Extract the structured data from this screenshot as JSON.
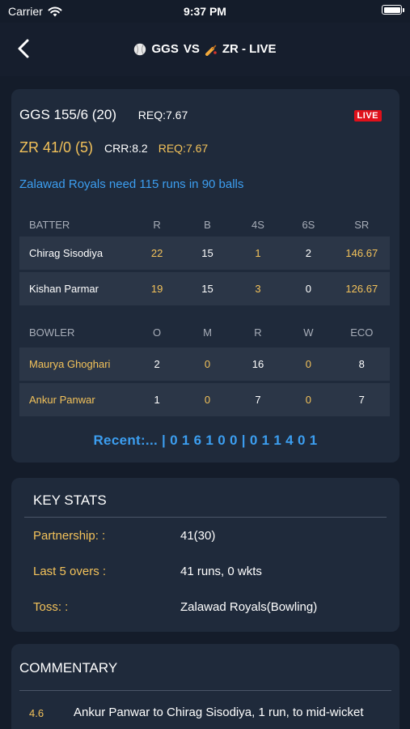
{
  "status_bar": {
    "carrier": "Carrier",
    "time": "9:37 PM"
  },
  "nav": {
    "team_a": "GGS",
    "vs": "VS",
    "team_b": "ZR - LIVE"
  },
  "score": {
    "team_a_score": "GGS 155/6 (20)",
    "team_a_req": "REQ:7.67",
    "live_badge": "LIVE",
    "team_b_score": "ZR 41/0 (5)",
    "team_b_crr": "CRR:8.2",
    "team_b_req": "REQ:7.67",
    "need_text": "Zalawad Royals need 115 runs in 90 balls",
    "accent": "#f3c25a",
    "link_color": "#3c9ef0"
  },
  "batting": {
    "headers": [
      "BATTER",
      "R",
      "B",
      "4S",
      "6S",
      "SR"
    ],
    "rows": [
      [
        "Chirag Sisodiya",
        "22",
        "15",
        "1",
        "2",
        "146.67"
      ],
      [
        "Kishan Parmar",
        "19",
        "15",
        "3",
        "0",
        "126.67"
      ]
    ]
  },
  "bowling": {
    "headers": [
      "BOWLER",
      "O",
      "M",
      "R",
      "W",
      "ECO"
    ],
    "rows": [
      [
        "Maurya Ghoghari",
        "2",
        "0",
        "16",
        "0",
        "8"
      ],
      [
        "Ankur Panwar",
        "1",
        "0",
        "7",
        "0",
        "7"
      ]
    ]
  },
  "recent": "Recent:... | 0 1 6 1 0 0 | 0 1 1 4 0 1",
  "key_stats": {
    "title": "KEY STATS",
    "rows": [
      {
        "label": "Partnership:  :",
        "value": "41(30)"
      },
      {
        "label": "Last 5 overs   :",
        "value": "41 runs, 0 wkts"
      },
      {
        "label": "Toss:  :",
        "value": "Zalawad Royals(Bowling)"
      }
    ]
  },
  "commentary": {
    "title": "COMMENTARY",
    "items": [
      {
        "over": "4.6",
        "text": "Ankur Panwar to Chirag Sisodiya, 1 run, to mid-wicket"
      }
    ]
  },
  "icons": {
    "back": "chevron-left-icon",
    "wifi": "wifi-icon",
    "battery": "battery-icon",
    "ball": "cricket-ball-icon",
    "bat": "cricket-bat-icon"
  }
}
